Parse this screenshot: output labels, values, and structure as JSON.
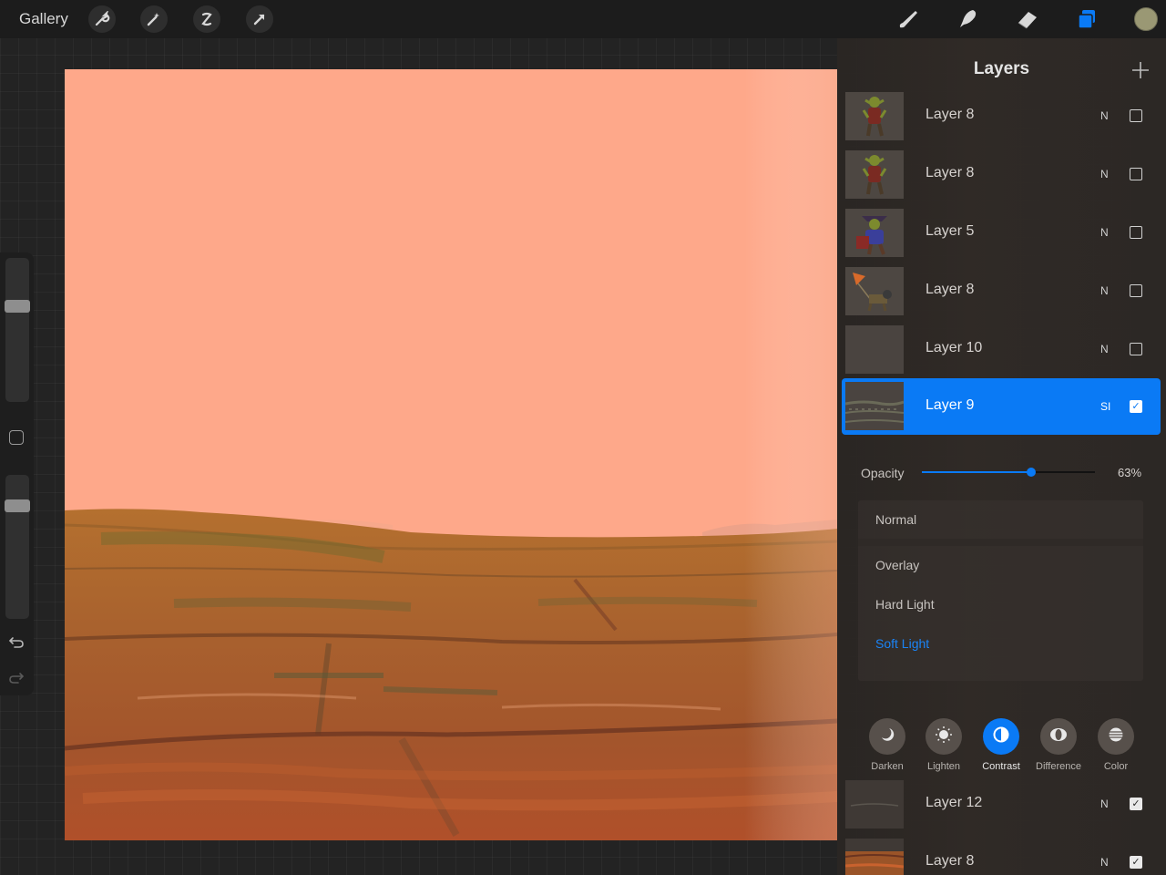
{
  "topbar": {
    "gallery_label": "Gallery",
    "left_tools": [
      "wrench-icon",
      "magic-wand-icon",
      "selection-icon",
      "transform-arrow-icon"
    ],
    "right_tools": [
      "brush-icon",
      "smudge-icon",
      "eraser-icon",
      "layers-icon"
    ],
    "color_swatch": "#9a9874",
    "active_tool_color": "#0a7af5"
  },
  "sidebar": {
    "brush_size_level": 0.32,
    "opacity_level": 0.2,
    "undo_icon": "undo-icon",
    "redo_icon": "redo-icon"
  },
  "canvas": {
    "sky_color": "#fea88a",
    "ground_color": "#a55a2c"
  },
  "layers_panel": {
    "title": "Layers",
    "add_icon": "plus-icon",
    "layers": [
      {
        "name": "Layer 8",
        "blend": "N",
        "visible": false,
        "thumb": "goblin"
      },
      {
        "name": "Layer 8",
        "blend": "N",
        "visible": false,
        "thumb": "goblin"
      },
      {
        "name": "Layer 5",
        "blend": "N",
        "visible": false,
        "thumb": "goblin-blue"
      },
      {
        "name": "Layer 8",
        "blend": "N",
        "visible": false,
        "thumb": "balloon"
      },
      {
        "name": "Layer 10",
        "blend": "N",
        "visible": false,
        "thumb": "empty"
      },
      {
        "name": "Layer 9",
        "blend": "SI",
        "visible": true,
        "thumb": "ground",
        "active": true
      }
    ],
    "opacity_label": "Opacity",
    "opacity_value": "63%",
    "opacity_fraction": 0.63,
    "blend_modes": [
      "Normal",
      "Overlay",
      "Hard Light",
      "Soft Light"
    ],
    "selected_blend_mode": "Soft Light",
    "blend_categories": [
      {
        "label": "Darken",
        "icon": "moon-icon"
      },
      {
        "label": "Lighten",
        "icon": "sun-icon"
      },
      {
        "label": "Contrast",
        "icon": "contrast-icon",
        "active": true
      },
      {
        "label": "Difference",
        "icon": "difference-icon"
      },
      {
        "label": "Color",
        "icon": "color-mode-icon"
      }
    ],
    "lower_layers": [
      {
        "name": "Layer 12",
        "blend": "N",
        "visible": true,
        "thumb": "empty-dark"
      },
      {
        "name": "Layer 8",
        "blend": "N",
        "visible": true,
        "thumb": "ground-orange"
      }
    ]
  }
}
